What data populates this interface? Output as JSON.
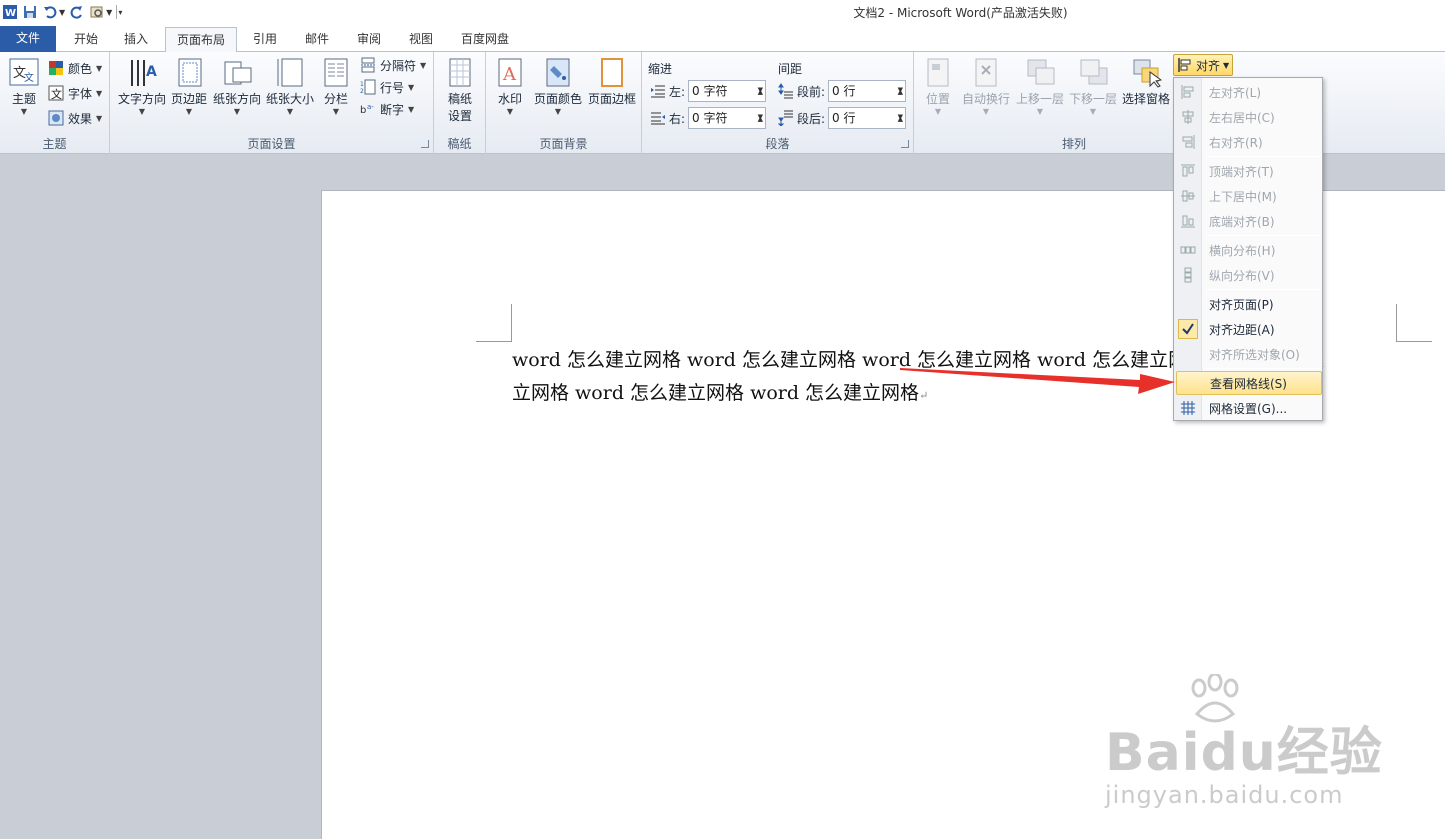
{
  "window": {
    "title": "文档2 -  Microsoft Word(产品激活失败)"
  },
  "tabs": [
    {
      "label": "文件"
    },
    {
      "label": "开始"
    },
    {
      "label": "插入"
    },
    {
      "label": "页面布局"
    },
    {
      "label": "引用"
    },
    {
      "label": "邮件"
    },
    {
      "label": "审阅"
    },
    {
      "label": "视图"
    },
    {
      "label": "百度网盘"
    }
  ],
  "ribbon": {
    "theme": {
      "group": "主题",
      "main": "主题",
      "colors": "颜色",
      "fonts": "字体",
      "effects": "效果"
    },
    "page_setup": {
      "group": "页面设置",
      "text_direction": "文字方向",
      "margins": "页边距",
      "orientation": "纸张方向",
      "size": "纸张大小",
      "columns": "分栏",
      "breaks": "分隔符",
      "line_numbers": "行号",
      "hyphenation": "断字"
    },
    "manuscript": {
      "group": "稿纸",
      "settings_line1": "稿纸",
      "settings_line2": "设置"
    },
    "page_background": {
      "group": "页面背景",
      "watermark": "水印",
      "page_color": "页面颜色",
      "page_borders": "页面边框"
    },
    "paragraph": {
      "group": "段落",
      "indent": "缩进",
      "spacing": "间距",
      "left_label": "左:",
      "left_value": "0 字符",
      "right_label": "右:",
      "right_value": "0 字符",
      "before_label": "段前:",
      "before_value": "0 行",
      "after_label": "段后:",
      "after_value": "0 行"
    },
    "arrange": {
      "group": "排列",
      "position": "位置",
      "wrap": "自动换行",
      "bring_forward": "上移一层",
      "send_backward": "下移一层",
      "selection_pane": "选择窗格",
      "align": "对齐"
    }
  },
  "align_menu": {
    "items": [
      {
        "label": "左对齐(L)",
        "disabled": true
      },
      {
        "label": "左右居中(C)",
        "disabled": true
      },
      {
        "label": "右对齐(R)",
        "disabled": true
      },
      {
        "label": "顶端对齐(T)",
        "disabled": true
      },
      {
        "label": "上下居中(M)",
        "disabled": true
      },
      {
        "label": "底端对齐(B)",
        "disabled": true
      },
      {
        "label": "横向分布(H)",
        "disabled": true
      },
      {
        "label": "纵向分布(V)",
        "disabled": true
      },
      {
        "label": "对齐页面(P)",
        "disabled": false
      },
      {
        "label": "对齐边距(A)",
        "disabled": false,
        "checked": true
      },
      {
        "label": "对齐所选对象(O)",
        "disabled": true
      },
      {
        "label": "查看网格线(S)",
        "disabled": false,
        "highlighted": true
      },
      {
        "label": "网格设置(G)...",
        "disabled": false
      }
    ]
  },
  "document": {
    "line1": "word 怎么建立网格 word 怎么建立网格 word 怎么建立网格 word 怎么建立网格 word 怎么建",
    "line2": "立网格 word 怎么建立网格 word 怎么建立网格"
  },
  "watermark": {
    "brand": "Bai",
    "brand2": "du经验",
    "url": "jingyan.baidu.com"
  },
  "colors": {
    "file_tab": "#2a5ca8",
    "highlight": "#ffe28c",
    "arrow": "#e8302a"
  }
}
